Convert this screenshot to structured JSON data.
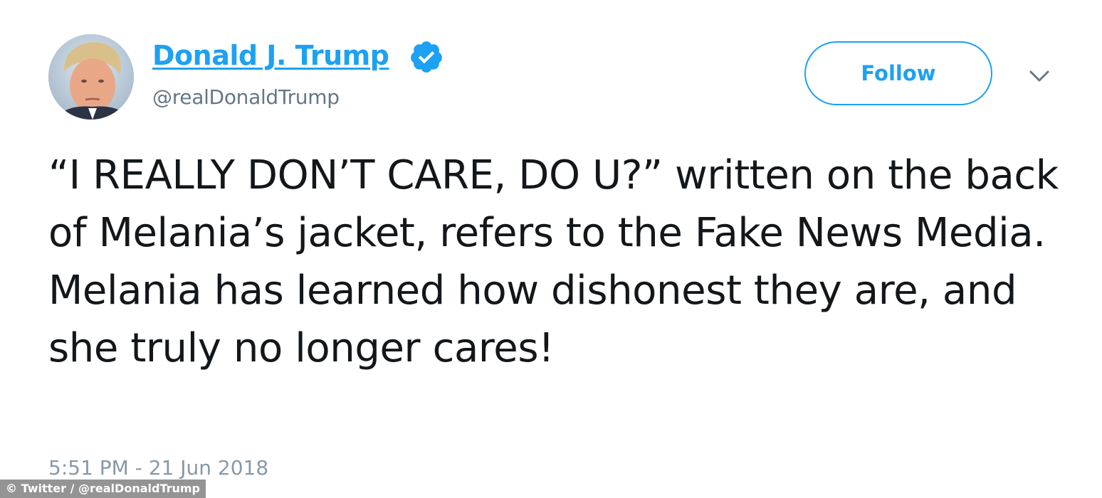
{
  "author": {
    "display_name": "Donald J. Trump",
    "handle": "@realDonaldTrump",
    "verified": true,
    "avatar_icon": "profile-photo",
    "verified_icon": "verified-badge-icon"
  },
  "actions": {
    "follow_label": "Follow",
    "more_icon": "chevron-down-icon"
  },
  "tweet": {
    "text": "“I REALLY DON’T CARE, DO U?” written on the back of Melania’s jacket, refers to the Fake News Media. Melania has learned how dishonest they are, and she truly no longer cares!",
    "timestamp": "5:51 PM - 21 Jun 2018"
  },
  "credit": {
    "text": "© Twitter / @realDonaldTrump"
  },
  "colors": {
    "accent": "#1da1f2",
    "text": "#14171a",
    "secondary": "#657786",
    "timestamp": "#8899a6",
    "background": "#ffffff"
  }
}
